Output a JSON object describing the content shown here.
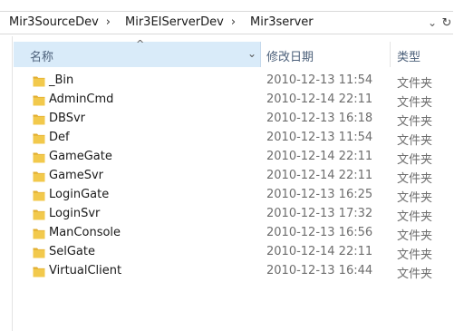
{
  "address": {
    "crumbs": [
      "Mir3SourceDev",
      "Mir3EIServerDev",
      "Mir3server"
    ],
    "separator": "›",
    "dropdown_icon": "chevron-down-icon",
    "refresh_icon": "refresh-icon"
  },
  "columns": {
    "name": "名称",
    "date": "修改日期",
    "type": "类型",
    "sort_indicator": "^"
  },
  "files": [
    {
      "name": "_Bin",
      "date": "2010-12-13 11:54",
      "type": "文件夹"
    },
    {
      "name": "AdminCmd",
      "date": "2010-12-14 22:11",
      "type": "文件夹"
    },
    {
      "name": "DBSvr",
      "date": "2010-12-13 16:18",
      "type": "文件夹"
    },
    {
      "name": "Def",
      "date": "2010-12-13 11:54",
      "type": "文件夹"
    },
    {
      "name": "GameGate",
      "date": "2010-12-14 22:11",
      "type": "文件夹"
    },
    {
      "name": "GameSvr",
      "date": "2010-12-14 22:11",
      "type": "文件夹"
    },
    {
      "name": "LoginGate",
      "date": "2010-12-13 16:25",
      "type": "文件夹"
    },
    {
      "name": "LoginSvr",
      "date": "2010-12-13 17:32",
      "type": "文件夹"
    },
    {
      "name": "ManConsole",
      "date": "2010-12-13 16:56",
      "type": "文件夹"
    },
    {
      "name": "SelGate",
      "date": "2010-12-14 22:11",
      "type": "文件夹"
    },
    {
      "name": "VirtualClient",
      "date": "2010-12-13 16:44",
      "type": "文件夹"
    }
  ],
  "colors": {
    "folder": "#f2c94c",
    "folder_dark": "#e1ad2f",
    "header_selected": "#d9ebf9"
  }
}
